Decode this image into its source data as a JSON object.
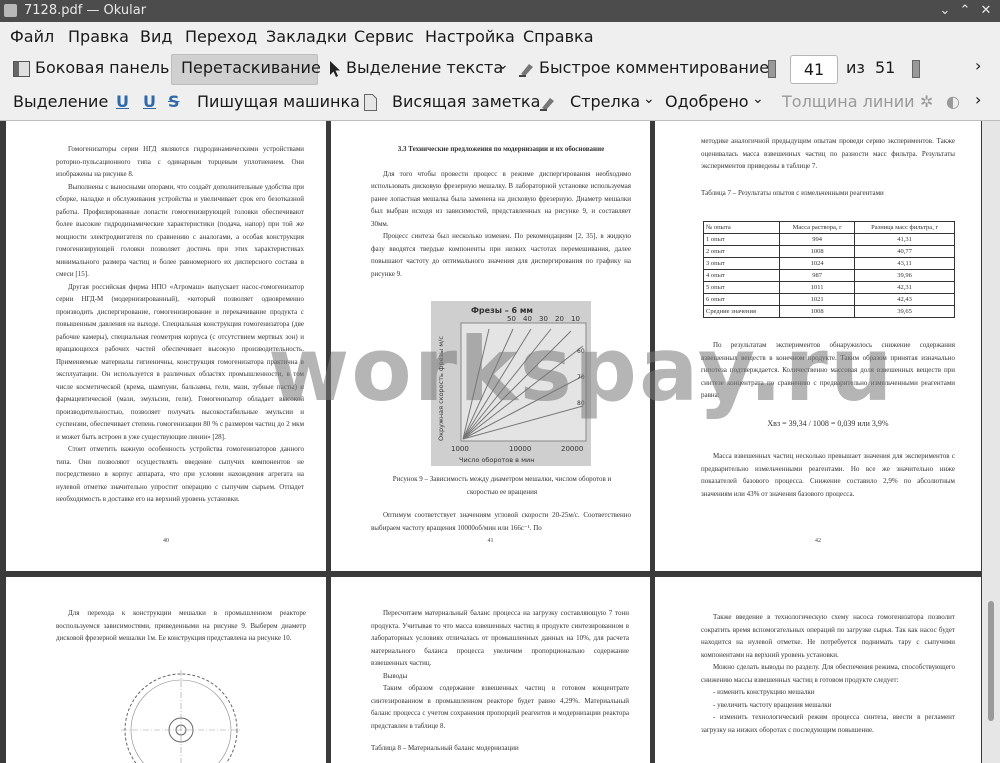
{
  "window": {
    "title": "7128.pdf  — Okular"
  },
  "menu": [
    "Файл",
    "Правка",
    "Вид",
    "Переход",
    "Закладки",
    "Сервис",
    "Настройка",
    "Справка"
  ],
  "toolbar1": {
    "sidebar": "Боковая панель",
    "drag": "Перетаскивание",
    "text_select": "Выделение текста",
    "quick_comment": "Быстрое комментирование",
    "page_current": "41",
    "page_of": "из",
    "page_total": "51"
  },
  "toolbar2": {
    "select": "Выделение",
    "typewriter": "Пишущая машинка",
    "sticky": "Висящая заметка",
    "arrow": "Стрелка",
    "approved": "Одобрено",
    "line_width": "Толщина линии"
  },
  "watermark": "workspay.ru",
  "page40": {
    "paras": [
      "Гомогенизаторы серии НГД являются гидродинамическими устройствами роторно-пульсационного типа с одинарным торцевым уплотнением. Они изображены на рисунке 8.",
      "Выполнены с выносными опорами, что создаёт дополнительные удобства при сборке, наладке и обслуживания устройства и увеличивает срок его безотказной работы. Профилированные лопасти гомогенизирующей головки обеспечивают более высокие гидродинамические характеристики (подача, напор) при той же мощности электродвигателя по сравнению с аналогами, а особая конструкция гомогенизирующей головки позволяет достичь при этих характеристиках минимального размера частиц и более равномерного их дисперсного состава в смеси [15].",
      "Другая российская фирма НПО «Агромаш» выпускает насос-гомогенизатор серии НГД-М (модернизированный), «который позволяет одновременно производить диспергирование, гомогенизирование и перекачивание продукта с повышенным давления на выходе. Специальная конструкция гомогенизатора (две рабочие камеры), специальная геометрия корпуса (с отсутствием мертвых зон) и вращающихся рабочих частей обеспечивает высокую производительность. Применяемые материалы гигиеничны, конструкция гомогенизатора практична в эксплуатации. Он используется в различных областях промышленности, в том числе косметической (крема, шампуни, бальзамы, гели, мази, зубные пасты) и фармацевтической (мази, эмульсии, гели). Гомогенизатор обладает высокой производительностью, позволяет получать высокостабильные эмульсии и суспензии, обеспечивает степень гомогенизации 80 % с размером частиц до 2 мкм и может быть встроен в уже существующие линии» [28].",
      "Стоит отметить важную особенность устройства гомогенизаторов данного типа. Они позволяют осуществлять введение сыпучих компонентов не посредственно в корпус аппарата, что при условии нахождения агрегата на нулевой отметке значительно упростит операцию с сыпучим сырьем. Отпадет необходимость в доставке его на верхний уровень установки."
    ],
    "num": "40"
  },
  "page41": {
    "heading": "3.3 Технические предложения по модернизации и их обоснование",
    "paras": [
      "Для того чтобы провести процесс в режиме диспергирования необходимо использовать дисковую фрезерную мешалку. В лабораторной установке используемая ранее лопастная мешалка была заменена на дисковую фрезерную. Диаметр мешалки был выбран исходя из зависимостей, представленных на рисунке 9, и составляет 30мм.",
      "Процесс синтеза был несколько изменен. По рекомендациям [2, 35], в жидкую фазу вводятся твердые компоненты при низких частотах перемешивания, далее повышают частоту до оптимального значения для диспергирования по графику на рисунке 9."
    ],
    "fig_title": "Фрезы – 6 мм",
    "fig_ylabel": "Окружная скорость фрезы м/с",
    "fig_xlabel": "Число оборотов в мин",
    "fig_labels": [
      "50",
      "40",
      "30",
      "20",
      "10",
      "60",
      "70",
      "80",
      "1000",
      "10000",
      "20000"
    ],
    "caption": "Рисунок 9 – Зависимость между диаметром мешалки, числом оборотов и скоростью ее вращения",
    "after": [
      "Оптимум соответствует значениям угловой скорости 20-25м/с. Соответственно выбираем частоту вращения 10000об/мин или 166с⁻¹. По"
    ],
    "num": "41"
  },
  "page42": {
    "top": "методике аналогичной предыдущим опытам проведи серию экспериментов. Также оценивалась масса взвешенных частиц по разности масс фильтра. Результаты экспериментов приведены в таблице 7.",
    "table_title": "Таблица 7 – Результаты опытов с измельченными реагентами",
    "headers": [
      "№ опыта",
      "Масса раствора, г",
      "Разница масс фильтра, г"
    ],
    "rows": [
      [
        "1 опыт",
        "994",
        "41,31"
      ],
      [
        "2 опыт",
        "1008",
        "40,77"
      ],
      [
        "3 опыт",
        "1024",
        "43,11"
      ],
      [
        "4 опыт",
        "987",
        "39,96"
      ],
      [
        "5 опыт",
        "1011",
        "42,31"
      ],
      [
        "6 опыт",
        "1021",
        "42,43"
      ],
      [
        "Средние значения",
        "1008",
        "39,65"
      ]
    ],
    "para1": "По результатам экспериментов обнаружилось снижение содержания взвешенных веществ в конечном продукте. Таким образом принятая изначально гипотеза подтверждается. Количественно массовая доля взвешенных веществ при синтезе концентрата по сравнению с предварительно измельченными реагентами равна:",
    "formula": "Xвз = 39,34 / 1008 = 0,039 или 3,9%",
    "para2": "Масса взвешенных частиц несколько превышает значения для экспериментов с предварительно измельченными реагентами. Но все же значительно ниже показателей базового процесса. Снижение составило 2,9% по абсолютным значениям или 43% от значения базового процесса.",
    "num": "42"
  },
  "page43": {
    "paras": [
      "Для перехода к конструкции мешалки в промышленном реакторе воспользуемся зависимостями, приведенными на рисунке 9. Выберем диаметр дисковой фрезерной мешалки 1м. Ее конструкция представлена на рисунке 10."
    ]
  },
  "page44": {
    "paras": [
      "Пересчитаем материальный баланс процесса на загрузку составляющую 7 тонн продукта. Учитывая то что масса взвешенных частиц в продукте синтезированном в лабораторных условиях отличалась от промышленных данных на 10%, для расчета материального баланса процесса увеличим пропорционально содержание взвешенных частиц.",
      "Выводы",
      "Таким образом содержание взвешенных частиц в готовом концентрате синтезированном в промышленном реакторе будет равно 4,29%. Материальный баланс процесса с учетом сохранения пропорций реагентов и модернизации реактора представлен в таблице 8."
    ],
    "cut": "Таблица 8 – Материальный баланс модернизации"
  },
  "page45": {
    "paras": [
      "Также введение в технологическую схему насоса гомогенизатора позволит сократить время вспомогательных операций по загрузке сырья. Так как насос будет находится на нулевой отметке. Не потребуется поднимать тару с сыпучими компонентами на верхний уровень установки.",
      "Можно сделать выводы по разделу. Для обеспечения режима, способствующего снижению массы взвешенных частиц в готовом продукте следует:",
      "- изменить конструкцию мешалки",
      "- увеличить частоту вращения мешалки",
      "- изменить технологический режим процесса синтеза, ввести в регламент загрузку на низких оборотах с последующим повышение."
    ]
  }
}
